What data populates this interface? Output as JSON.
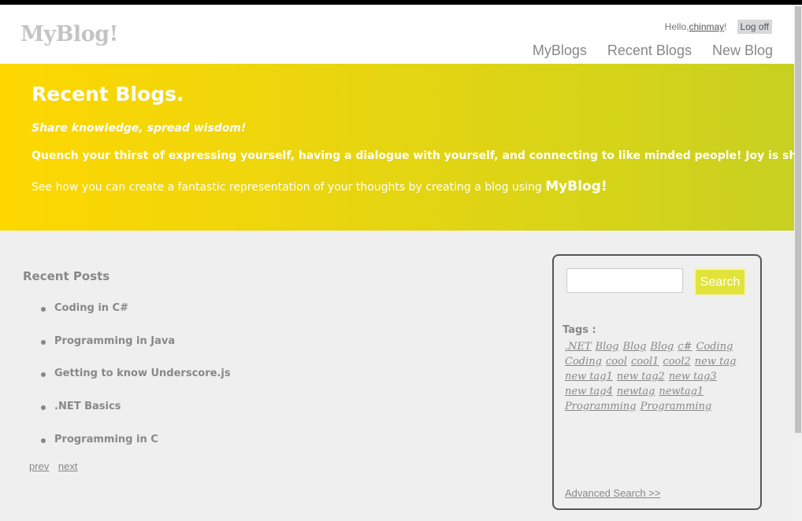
{
  "header": {
    "logo": "MyBlog!",
    "greeting": "Hello, ",
    "username": "chinmay",
    "exclaim": "!",
    "logoff": "Log off",
    "nav": [
      "MyBlogs",
      "Recent Blogs",
      "New Blog"
    ]
  },
  "featured": {
    "title": "Recent Blogs.",
    "tagline": "Share knowledge, spread wisdom!",
    "quench": "Quench your thirst of expressing yourself, having a dialogue with yourself, and connecting to like minded people! Joy is sharing!",
    "seehow": "See how you can create a fantastic representation of your thoughts by creating a blog using ",
    "brand": "MyBlog!"
  },
  "recent": {
    "title": "Recent Posts",
    "posts": [
      "Coding in C#",
      "Programming in Java",
      "Getting to know Underscore.js",
      ".NET Basics",
      "Programming in C"
    ],
    "prev": "prev",
    "next": "next"
  },
  "sidebar": {
    "search_value": "",
    "search_button": "Search",
    "tags_label": "Tags :",
    "tags": [
      ".NET",
      "Blog",
      "Blog",
      "Blog",
      "c#",
      "Coding",
      "Coding",
      "cool",
      "cool1",
      "cool2",
      "new tag",
      "new tag1",
      "new tag2",
      "new tag3",
      "new tag4",
      "newtag",
      "newtag1",
      "Programming",
      "Programming"
    ],
    "advanced": "Advanced Search >>"
  }
}
